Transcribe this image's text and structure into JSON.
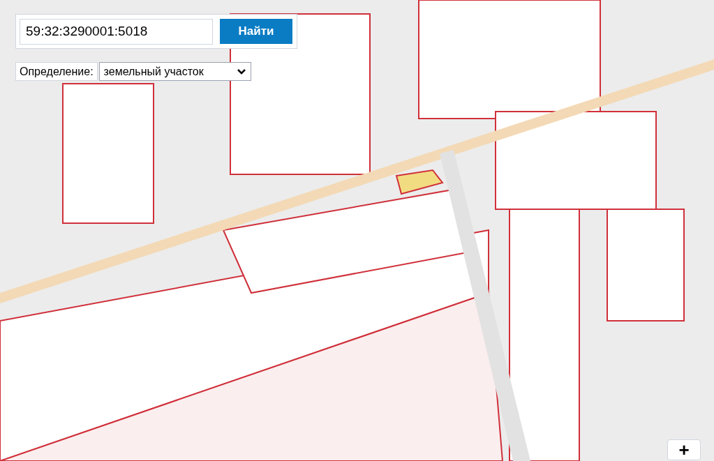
{
  "search": {
    "value": "59:32:3290001:5018",
    "button": "Найти"
  },
  "definition": {
    "label": "Определение:",
    "value": "земельный участок"
  },
  "zoom_in": {
    "label": "+"
  }
}
